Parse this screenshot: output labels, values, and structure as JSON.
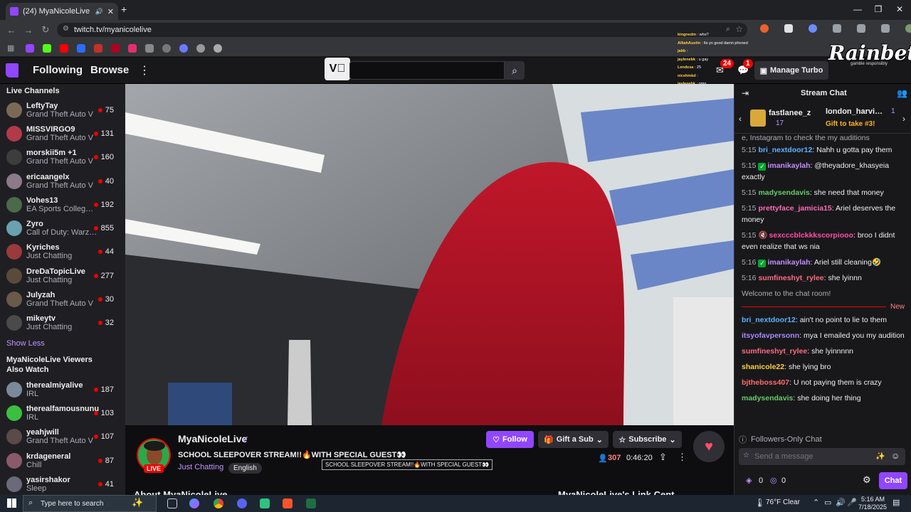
{
  "browser": {
    "tab_title": "(24) MyaNicoleLive - Twitch",
    "url": "twitch.tv/myanicolelive"
  },
  "nav": {
    "following": "Following",
    "browse": "Browse",
    "notif_count": "24",
    "whisper_count": "1",
    "manage_turbo": "Manage Turbo"
  },
  "sidebar": {
    "live_title": "Live Channels",
    "channels": [
      {
        "name": "LeftyTay",
        "game": "Grand Theft Auto V",
        "viewers": "75",
        "color": "#7a6a55"
      },
      {
        "name": "MISSVIRGO9",
        "game": "Grand Theft Auto V",
        "viewers": "131",
        "color": "#b23a48"
      },
      {
        "name": "morskii5m +1",
        "game": "Grand Theft Auto V",
        "viewers": "160",
        "color": "#3d3d3d"
      },
      {
        "name": "ericaangelx",
        "game": "Grand Theft Auto V",
        "viewers": "40",
        "color": "#8a7a8a"
      },
      {
        "name": "Vohes13",
        "game": "EA Sports Colleg…",
        "viewers": "192",
        "color": "#4a6a4a"
      },
      {
        "name": "Zyro",
        "game": "Call of Duty: Warz…",
        "viewers": "855",
        "color": "#6aa0b0"
      },
      {
        "name": "Kyriches",
        "game": "Just Chatting",
        "viewers": "44",
        "color": "#9a3a3a"
      },
      {
        "name": "DreDaTopicLive",
        "game": "Just Chatting",
        "viewers": "277",
        "color": "#5a4a3a"
      },
      {
        "name": "Julyzah",
        "game": "Grand Theft Auto V",
        "viewers": "30",
        "color": "#6a5a4a"
      },
      {
        "name": "mikeytv",
        "game": "Just Chatting",
        "viewers": "32",
        "color": "#4a4a4a"
      }
    ],
    "show_less": "Show Less",
    "also_watch_title": "MyaNicoleLive Viewers Also Watch",
    "also_watch": [
      {
        "name": "therealmiyalive",
        "game": "IRL",
        "viewers": "187",
        "color": "#7a8a9a"
      },
      {
        "name": "therealfamousnunu",
        "game": "IRL",
        "viewers": "103",
        "color": "#3ac040"
      },
      {
        "name": "yeahjwill",
        "game": "Grand Theft Auto V",
        "viewers": "107",
        "color": "#5a4a4a"
      },
      {
        "name": "krdageneral",
        "game": "Chill",
        "viewers": "87",
        "color": "#8a5a6a"
      },
      {
        "name": "yasirshakor",
        "game": "Sleep",
        "viewers": "41",
        "color": "#6a6a7a"
      }
    ]
  },
  "stream": {
    "channel": "MyaNicoleLive",
    "live_label": "LIVE",
    "title": "SCHOOL SLEEPOVER STREAM!!🔥WITH SPECIAL GUEST👀",
    "tooltip": "SCHOOL SLEEPOVER STREAM!!🔥WITH SPECIAL GUEST👀",
    "category": "Just Chatting",
    "tag": "English",
    "viewers": "307",
    "uptime": "0:46:20",
    "follow": "Follow",
    "gift_sub": "Gift a Sub",
    "subscribe": "Subscribe",
    "about_partial": "About MyaNicoleLive",
    "links_partial": "MyaNicoleLive's Link Cent"
  },
  "chat": {
    "header": "Stream Chat",
    "gift_user1": "fastlanee_z",
    "gift_count1": "17",
    "gift_user2": "london_harvi…",
    "gift_count2": "1",
    "gift_cta": "Gift to take #3!",
    "cut_line": "e, Instagram to check the my auditions",
    "messages": [
      {
        "time": "5:15",
        "user": "bri_nextdoor12",
        "color": "#5cb3ff",
        "badge": "",
        "text": "Nahh u gotta pay them"
      },
      {
        "time": "5:15",
        "user": "imanikaylah",
        "color": "#c58cff",
        "badge": "check",
        "text": "@theyadore_khasyeia exactly"
      },
      {
        "time": "5:15",
        "user": "madysendavis",
        "color": "#66cc66",
        "badge": "",
        "text": "she need that money"
      },
      {
        "time": "5:15",
        "user": "prettyface_jamicia15",
        "color": "#ff69b4",
        "badge": "",
        "text": "Ariel deserves the money"
      },
      {
        "time": "5:15",
        "user": "sexcccblckkkscorpiooo",
        "color": "#ff4da6",
        "badge": "mute",
        "text": "broo I didnt even realize that ws nia"
      },
      {
        "time": "5:16",
        "user": "imanikaylah",
        "color": "#c58cff",
        "badge": "check",
        "text": "Ariel still cleaning🤣"
      },
      {
        "time": "5:16",
        "user": "sumfineshyt_rylee",
        "color": "#ff6b81",
        "badge": "",
        "text": "she lyinnn"
      }
    ],
    "welcome": "Welcome to the chat room!",
    "new_label": "New",
    "messages2": [
      {
        "user": "bri_nextdoor12",
        "color": "#5cb3ff",
        "text": "ain't no point to lie to them"
      },
      {
        "user": "itsyofavpersonn",
        "color": "#a78bfa",
        "text": "mya I emailed you my audition"
      },
      {
        "user": "sumfineshyt_rylee",
        "color": "#ff6b81",
        "text": "she lyinnnnn"
      },
      {
        "user": "shanicole22",
        "color": "#ffd23f",
        "text": "she lying bro"
      },
      {
        "user": "bjtheboss407",
        "color": "#ff6b6b",
        "text": "U not paying them is crazy"
      },
      {
        "user": "madysendavis",
        "color": "#66cc66",
        "text": "she doing her thing"
      }
    ],
    "followers_only": "Followers-Only Chat",
    "placeholder": "Send a message",
    "points": "0",
    "other_points": "0",
    "send": "Chat"
  },
  "overlay": {
    "brand": "Rainbet",
    "brand_sub": "gamble responsibly",
    "lines": [
      {
        "user": "kingnedm",
        "text": "who?"
      },
      {
        "user": "AlliahAustin",
        "text": "Its yo good damn phoned"
      },
      {
        "user": "jabb",
        "text": ""
      },
      {
        "user": "jaylenebk",
        "text": "u gay"
      },
      {
        "user": "Lendesa",
        "text": "25"
      },
      {
        "user": "nicehinkd",
        "text": ""
      },
      {
        "user": "jaylenebk",
        "text": "omg"
      },
      {
        "user": "dottytheboom",
        "text": "like ddg say"
      }
    ]
  },
  "taskbar": {
    "search": "Type here to search",
    "weather": "76°F  Clear",
    "time": "5:16 AM",
    "date": "7/18/2025"
  }
}
